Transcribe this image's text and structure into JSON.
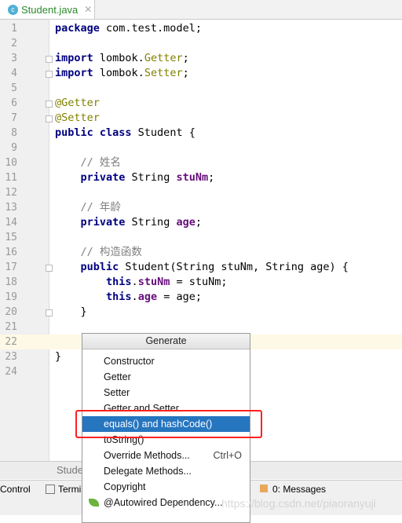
{
  "tab": {
    "title": "Student.java",
    "icon": "class-icon"
  },
  "code_lines": [
    {
      "n": "1",
      "html": "<span class='kw'>package</span> com.test.model;"
    },
    {
      "n": "2",
      "html": ""
    },
    {
      "n": "3",
      "html": "<span class='kw'>import</span> lombok.<span class='ann'>Getter</span>;"
    },
    {
      "n": "4",
      "html": "<span class='kw'>import</span> lombok.<span class='ann'>Setter</span>;"
    },
    {
      "n": "5",
      "html": ""
    },
    {
      "n": "6",
      "html": "<span class='ann'>@Getter</span>"
    },
    {
      "n": "7",
      "html": "<span class='ann'>@Setter</span>"
    },
    {
      "n": "8",
      "html": "<span class='kw'>public class</span> Student {"
    },
    {
      "n": "9",
      "html": ""
    },
    {
      "n": "10",
      "html": "    <span class='cm'>// 姓名</span>"
    },
    {
      "n": "11",
      "html": "    <span class='kw'>private</span> String <span class='fld'>stuNm</span>;"
    },
    {
      "n": "12",
      "html": ""
    },
    {
      "n": "13",
      "html": "    <span class='cm'>// 年龄</span>"
    },
    {
      "n": "14",
      "html": "    <span class='kw'>private</span> String <span class='fld'>age</span>;"
    },
    {
      "n": "15",
      "html": ""
    },
    {
      "n": "16",
      "html": "    <span class='cm'>// 构造函数</span>"
    },
    {
      "n": "17",
      "html": "    <span class='kw'>public</span> Student(String stuNm, String age) {"
    },
    {
      "n": "18",
      "html": "        <span class='kw'>this</span>.<span class='fld'>stuNm</span> = stuNm;"
    },
    {
      "n": "19",
      "html": "        <span class='kw'>this</span>.<span class='fld'>age</span> = age;"
    },
    {
      "n": "20",
      "html": "    }"
    },
    {
      "n": "21",
      "html": ""
    },
    {
      "n": "22",
      "html": ""
    },
    {
      "n": "23",
      "html": "}"
    },
    {
      "n": "24",
      "html": ""
    }
  ],
  "current_line": "22",
  "file_tab": "Stude",
  "toolbar": {
    "vcs": "Control",
    "terminal": "Termi",
    "messages": "0: Messages"
  },
  "popup": {
    "title": "Generate",
    "items": [
      {
        "label": "Constructor"
      },
      {
        "label": "Getter"
      },
      {
        "label": "Setter"
      },
      {
        "label": "Getter and Setter"
      },
      {
        "label": "equals() and hashCode()",
        "selected": true
      },
      {
        "label": "toString()"
      },
      {
        "label": "Override Methods...",
        "shortcut": "Ctrl+O"
      },
      {
        "label": "Delegate Methods..."
      },
      {
        "label": "Copyright"
      },
      {
        "label": "@Autowired Dependency...",
        "icon": "spring-leaf-icon"
      }
    ]
  },
  "watermark": "https://blog.csdn.net/piaoranyuji",
  "colors": {
    "selection": "#2675bf",
    "highlight_box": "#ff2020"
  }
}
